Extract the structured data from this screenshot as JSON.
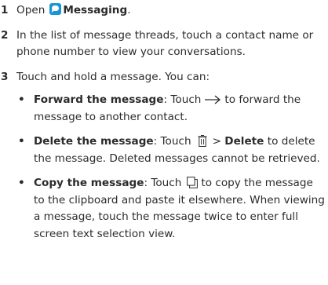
{
  "steps": [
    {
      "number": "1",
      "text_before": "Open",
      "app_icon": "messaging-app-icon",
      "app_name": "Messaging",
      "text_after": "."
    },
    {
      "number": "2",
      "text": "In the list of message threads, touch a contact name or phone number to view your conversations."
    },
    {
      "number": "3",
      "text": "Touch and hold a message. You can:",
      "options": [
        {
          "title": "Forward the message",
          "pre_icon": ": Touch",
          "icon": "arrow-right-icon",
          "post_icon": "to forward the message to another contact."
        },
        {
          "title": "Delete the message",
          "pre_icon": ": Touch",
          "icon": "trash-icon",
          "mid": ">",
          "mid_bold": "Delete",
          "post_icon": "to delete the message. Deleted messages cannot be retrieved."
        },
        {
          "title": "Copy the message",
          "pre_icon": ": Touch",
          "icon": "copy-icon",
          "post_icon": "to copy the message to the clipboard and paste it elsewhere. When viewing a message, touch the message twice to enter full screen text selection view."
        }
      ]
    }
  ],
  "colors": {
    "text": "#2b2b2b",
    "app_icon": "#1a95d3"
  }
}
